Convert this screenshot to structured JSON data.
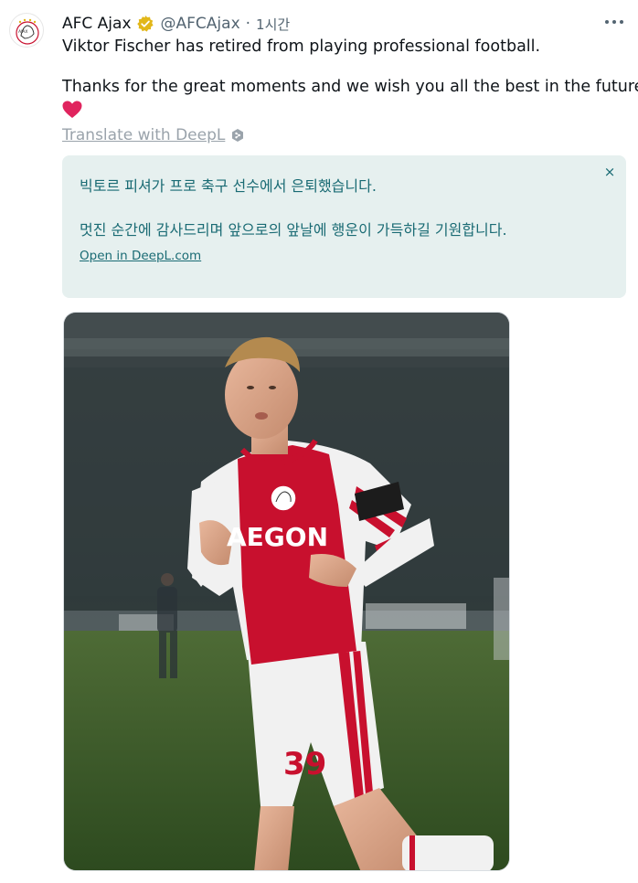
{
  "tweet": {
    "display_name": "AFC Ajax",
    "handle": "@AFCAjax",
    "separator": "·",
    "time": "1시간",
    "verified_icon": "verified-badge-gold",
    "more_icon": "more-horizontal-icon",
    "text_line_1": "Viktor Fischer has retired from playing professional football.",
    "text_line_2": "Thanks for the great moments and we wish you all the best in the future",
    "emoji": "heart"
  },
  "translation": {
    "link_label": "Translate with DeepL",
    "line_1": "빅토르 피셔가 프로 축구 선수에서 은퇴했습니다.",
    "line_2": "멋진 순간에 감사드리며 앞으로의 앞날에 행운이 가득하길 기원합니다.",
    "open_label": "Open in DeepL.com",
    "close_label": "×"
  },
  "media": {
    "photo_alt": "Ajax player celebrating in stadium",
    "shirt_sponsor": "AEGON",
    "shirt_number": "39"
  },
  "colors": {
    "text": "#0f1419",
    "muted": "#536471",
    "translation_bg": "#e6f0ef",
    "translation_text": "#1a6b74",
    "heart": "#e0245e",
    "verified": "#e2b719"
  }
}
